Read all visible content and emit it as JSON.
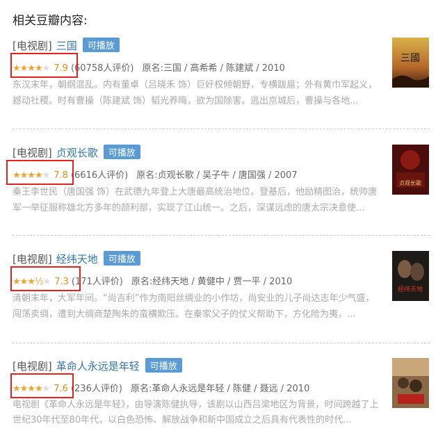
{
  "section_title": "相关豆瓣内容:",
  "items": [
    {
      "category": "[电视剧]",
      "title": "三国",
      "badge": "可播放",
      "stars_full": "★★★★",
      "stars_empty": "★",
      "score": "7.9",
      "count": "(60758人评价)",
      "original": "原名:三国 / 高希希 / 陈建斌 / 2010",
      "desc": "东汉末年，朝纲混乱。内有董卓（吕晓禾 饰）巨奸权倾朝野，专横跋扈；外有黄巾军起义，撼动社稷。时有曹操（陈建斌 饰）韬光养晦，欲为国除害。逃出京城后，曹操与各地..."
    },
    {
      "category": "[电视剧]",
      "title": "贞观长歌",
      "badge": "可播放",
      "stars_full": "★★★★",
      "stars_empty": "★",
      "score": "7.8",
      "count": "(6616人评价)",
      "original": "原名:贞观长歌 / 吴子牛 / 唐国强 / 2007",
      "desc": "秦王李世民（唐国强 饰）在武德九年登上大唐最高统治地位。登基后，他励精图治，统帅唐军一举征服称雄北方多年的颉利部，实现了江山统一。之后，深谋远虑的唐太宗决意使..."
    },
    {
      "category": "[电视剧]",
      "title": "经纬天地",
      "badge": "可播放",
      "stars_full": "★★★½",
      "stars_empty": "★",
      "score": "7.3",
      "count": "(171人评价)",
      "original": "原名:经纬天地 / 黄健中 / 贾一平 / 2010",
      "desc": "清朝末年，大军年间。“尚吉利”作为南阳丝绸业的小作坊，尚安业的儿子尚达志年少气盛，闯荡卖绸，遭到大绸商楚陶朱的蛮横欺压。在秦家父子的仗义帮助下，方化险为夷，..."
    },
    {
      "category": "[电视剧]",
      "title": "革命人永远是年轻",
      "badge": "可播放",
      "stars_full": "★★★★",
      "stars_empty": "★",
      "score": "7.6",
      "count": "(236人评价)",
      "original": "原名:革命人永远是年轻 / 陈健 / 聂远 / 2010",
      "desc": "电视剧《革命人永远是年轻》，由导演陈健执导，该剧以山西吕梁地区为背景，时间跨越了上世纪30年代至80年代，以白色恐怖、解放战争和新中国成立之后具有代表性的时代..."
    }
  ],
  "posters": [
    {
      "title": "三國"
    },
    {
      "title": "贞观长歌"
    },
    {
      "title": "经纬天地"
    },
    {
      "title": ""
    }
  ]
}
